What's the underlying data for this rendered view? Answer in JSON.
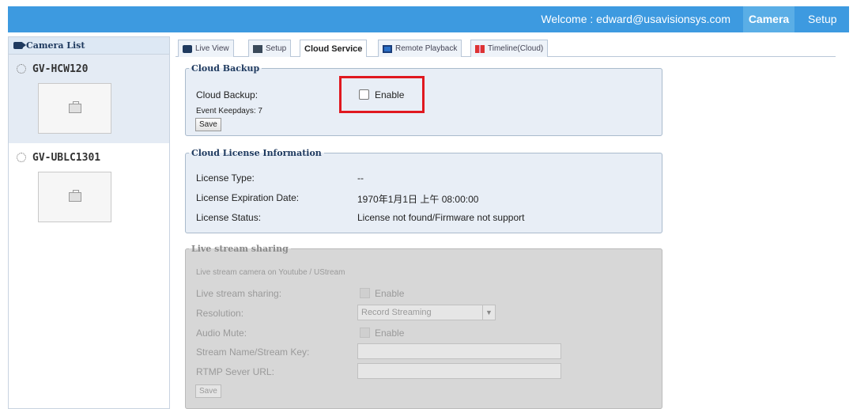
{
  "header": {
    "welcome": "Welcome : edward@usavisionsys.com",
    "nav_camera": "Camera",
    "nav_setup": "Setup",
    "bar_color": "#3d9ae0"
  },
  "sidebar": {
    "title": "Camera List",
    "cameras": [
      {
        "name": "GV-HCW120",
        "selected": true
      },
      {
        "name": "GV-UBLC1301",
        "selected": false
      }
    ]
  },
  "tabs": [
    {
      "label": "Live View",
      "icon": "camera-icon"
    },
    {
      "label": "Setup",
      "icon": "setup-icon"
    },
    {
      "label": "Cloud Service",
      "icon": "",
      "active": true
    },
    {
      "label": "Remote Playback",
      "icon": "remote-playback-icon"
    },
    {
      "label": "Timeline(Cloud)",
      "icon": "timeline-icon"
    }
  ],
  "cloud_backup": {
    "legend": "Cloud Backup",
    "backup_label": "Cloud Backup:",
    "enable_label": "Enable",
    "enabled": false,
    "keepdays_label": "Event Keepdays: 7",
    "save_label": "Save"
  },
  "license": {
    "legend": "Cloud License Information",
    "type_label": "License Type:",
    "type_value": "--",
    "expiration_label": "License Expiration Date:",
    "expiration_value": "1970年1月1日 上午 08:00:00",
    "status_label": "License Status:",
    "status_value": "License not found/Firmware not support"
  },
  "live_stream": {
    "legend": "Live stream sharing",
    "description": "Live stream camera on Youtube / UStream",
    "sharing_label": "Live stream sharing:",
    "sharing_enable": "Enable",
    "resolution_label": "Resolution:",
    "resolution_value": "Record Streaming",
    "audio_label": "Audio Mute:",
    "audio_enable": "Enable",
    "stream_name_label": "Stream Name/Stream Key:",
    "stream_name_value": "",
    "rtmp_label": "RTMP Sever URL:",
    "rtmp_value": "",
    "save_label": "Save"
  },
  "colors": {
    "highlight": "#e0181f",
    "panel": "#e8eef6",
    "disabled_panel": "#d7d7d7"
  }
}
